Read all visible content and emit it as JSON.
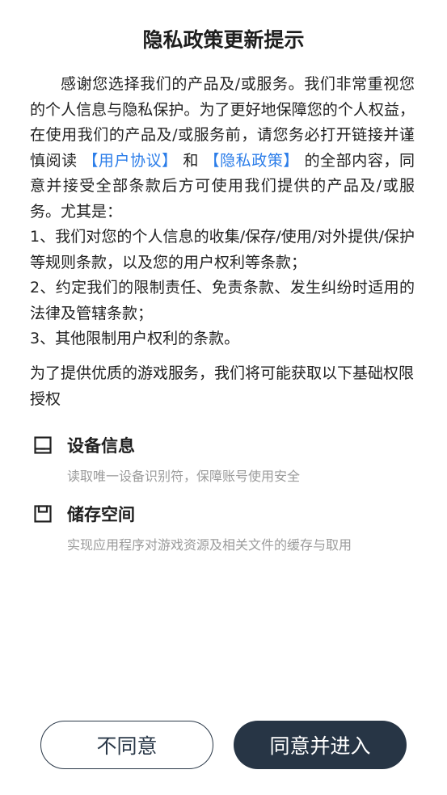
{
  "dialog": {
    "title": "隐私政策更新提示",
    "intro_before_links": "感谢您选择我们的产品及/或服务。我们非常重视您的个人信息与隐私保护。为了更好地保障您的个人权益，在使用我们的产品及/或服务前，请您务必打开链接并谨慎阅读 ",
    "user_agreement_link": "【用户协议】",
    "and_text": " 和 ",
    "privacy_policy_link": "【隐私政策】",
    "intro_after_links": " 的全部内容，同意并接受全部条款后方可使用我们提供的产品及/或服务。尤其是：",
    "terms": [
      "1、我们对您的个人信息的收集/保存/使用/对外提供/保护等规则条款，以及您的用户权利等条款；",
      "2、约定我们的限制责任、免责条款、发生纠纷时适用的法律及管辖条款；",
      "3、其他限制用户权利的条款。"
    ],
    "permissions_intro": "为了提供优质的游戏服务，我们将可能获取以下基础权限授权",
    "permissions": [
      {
        "icon": "device-icon",
        "title": "设备信息",
        "desc": "读取唯一设备识别符，保障账号使用安全"
      },
      {
        "icon": "storage-icon",
        "title": "储存空间",
        "desc": "实现应用程序对游戏资源及相关文件的缓存与取用"
      }
    ],
    "buttons": {
      "disagree": "不同意",
      "agree": "同意并进入"
    }
  },
  "colors": {
    "link": "#2b7de9",
    "primary_button": "#273545",
    "secondary_text": "#9b9b9b"
  }
}
